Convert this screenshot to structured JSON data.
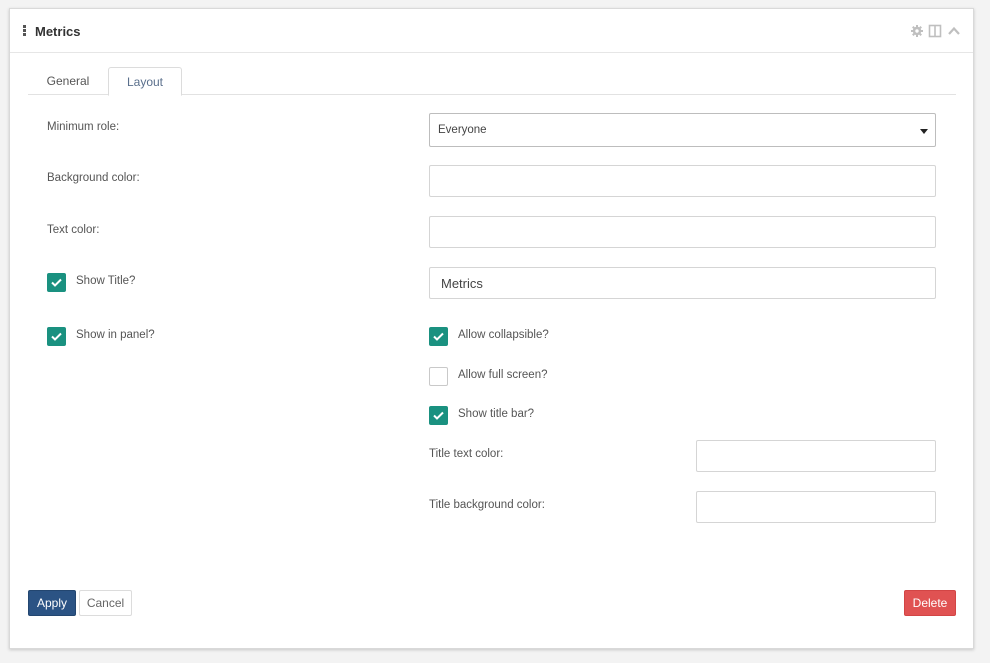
{
  "panel": {
    "title": "Metrics",
    "header_icons": [
      "drag-handle-icon",
      "gear-icon",
      "columns-icon",
      "chevron-up-icon"
    ]
  },
  "tabs": [
    {
      "label": "General",
      "active": false
    },
    {
      "label": "Layout",
      "active": true
    }
  ],
  "form": {
    "minimum_role": {
      "label": "Minimum role:",
      "value": "Everyone"
    },
    "background_color": {
      "label": "Background color:",
      "value": ""
    },
    "text_color": {
      "label": "Text color:",
      "value": ""
    },
    "show_title": {
      "label": "Show Title?",
      "checked": true,
      "title_value": "Metrics"
    },
    "show_in_panel": {
      "label": "Show in panel?",
      "checked": true
    },
    "allow_collapsible": {
      "label": "Allow collapsible?",
      "checked": true
    },
    "allow_full_screen": {
      "label": "Allow full screen?",
      "checked": false
    },
    "show_title_bar": {
      "label": "Show title bar?",
      "checked": true
    },
    "title_text_color": {
      "label": "Title text color:",
      "value": ""
    },
    "title_background_color": {
      "label": "Title background color:",
      "value": ""
    }
  },
  "buttons": {
    "apply": "Apply",
    "cancel": "Cancel",
    "delete": "Delete"
  },
  "colors": {
    "primary": "#2b5384",
    "checkbox": "#1a9180",
    "danger": "#e05252",
    "active_tab_text": "#5a6f8c"
  }
}
